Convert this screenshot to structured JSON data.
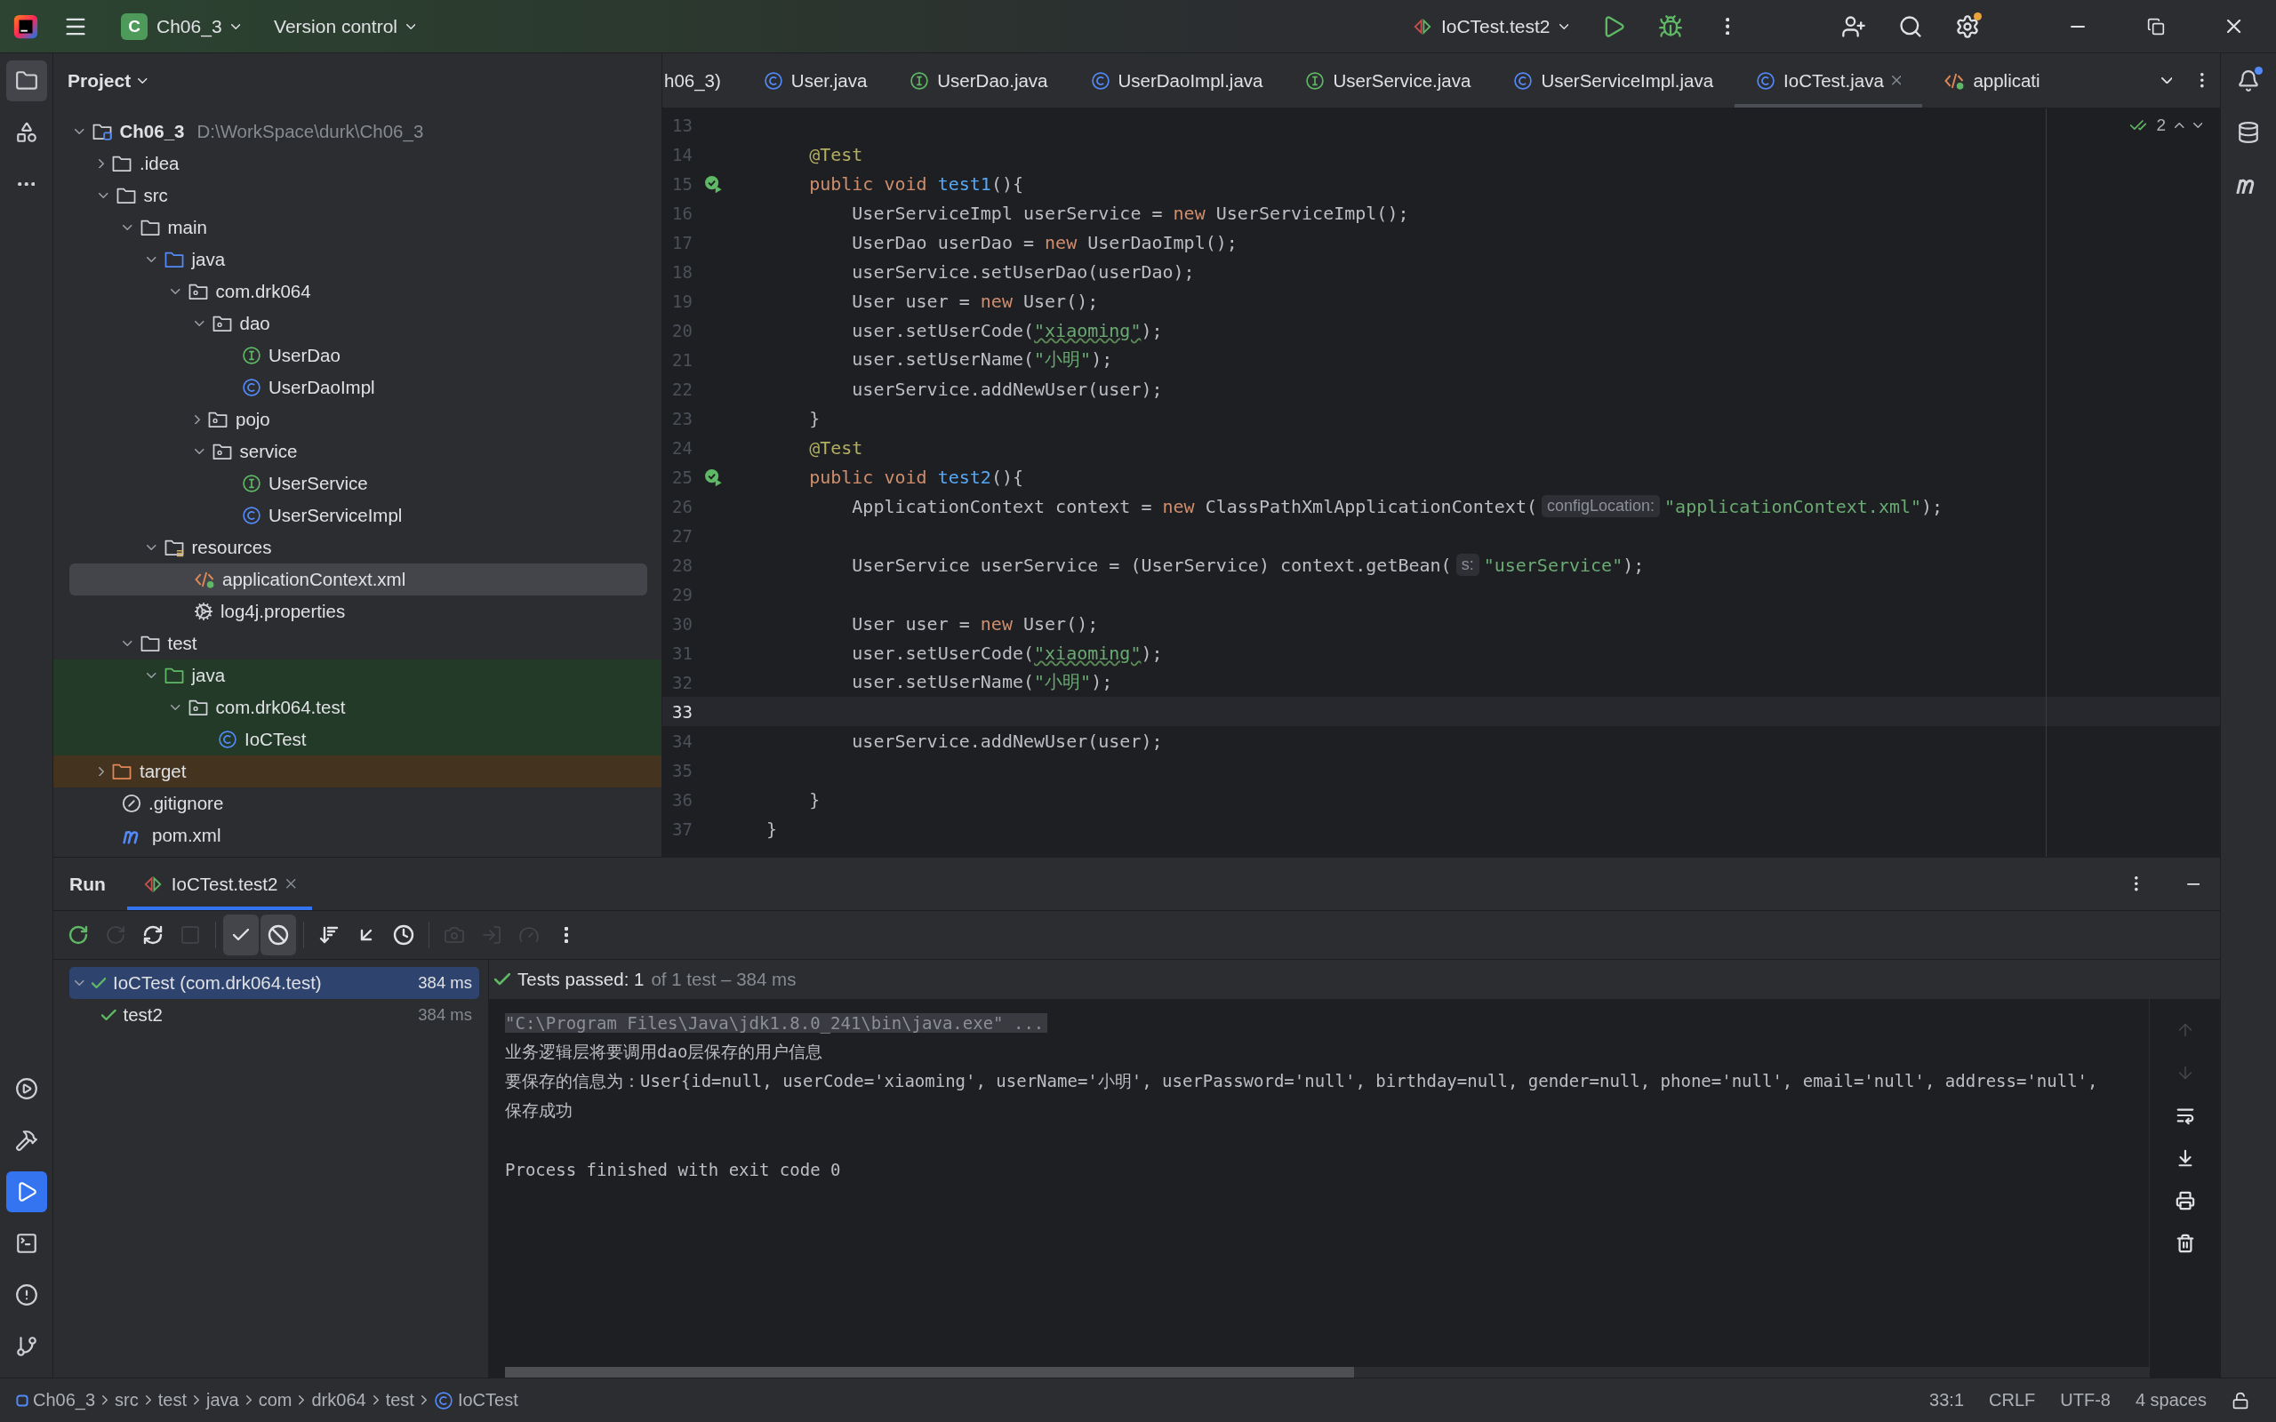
{
  "title_bar": {
    "project_badge": "C",
    "project": "Ch06_3",
    "vcs": "Version control",
    "run_config": "IoCTest.test2",
    "settings_badge": true
  },
  "left_tools": {
    "top": [
      {
        "kind": "project",
        "selected": true
      },
      {
        "kind": "structure",
        "selected": false
      },
      {
        "kind": "more",
        "selected": false
      }
    ],
    "bottom": [
      {
        "kind": "services",
        "selected": false
      },
      {
        "kind": "build",
        "selected": false
      },
      {
        "kind": "run",
        "selected": true
      },
      {
        "kind": "terminal",
        "selected": false
      },
      {
        "kind": "problems",
        "selected": false
      },
      {
        "kind": "git",
        "selected": false
      }
    ]
  },
  "right_tools": [
    {
      "kind": "notifications",
      "badge": true
    },
    {
      "kind": "database",
      "badge": false
    },
    {
      "kind": "maven",
      "badge": false
    }
  ],
  "project_panel": {
    "title": "Project",
    "tree": [
      {
        "label": "Ch06_3",
        "path": "D:\\WorkSpace\\durk\\Ch06_3",
        "kind": "module",
        "expanded": true,
        "selected": false,
        "test_sources": false,
        "children": [
          {
            "label": ".idea",
            "kind": "folder",
            "expanded": false,
            "selected": false,
            "test_sources": false
          },
          {
            "label": "src",
            "kind": "folder",
            "expanded": true,
            "selected": false,
            "test_sources": false,
            "children": [
              {
                "label": "main",
                "kind": "folder",
                "expanded": true,
                "selected": false,
                "test_sources": false,
                "children": [
                  {
                    "label": "java",
                    "kind": "source-folder",
                    "expanded": true,
                    "selected": false,
                    "test_sources": false,
                    "children": [
                      {
                        "label": "com.drk064",
                        "kind": "package",
                        "expanded": true,
                        "selected": false,
                        "test_sources": false,
                        "children": [
                          {
                            "label": "dao",
                            "kind": "package",
                            "expanded": true,
                            "selected": false,
                            "test_sources": false,
                            "children": [
                              {
                                "label": "UserDao",
                                "kind": "interface",
                                "selected": false,
                                "test_sources": false
                              },
                              {
                                "label": "UserDaoImpl",
                                "kind": "class",
                                "selected": false,
                                "test_sources": false
                              }
                            ]
                          },
                          {
                            "label": "pojo",
                            "kind": "package",
                            "expanded": false,
                            "selected": false,
                            "test_sources": false
                          },
                          {
                            "label": "service",
                            "kind": "package",
                            "expanded": true,
                            "selected": false,
                            "test_sources": false,
                            "children": [
                              {
                                "label": "UserService",
                                "kind": "interface",
                                "selected": false,
                                "test_sources": false
                              },
                              {
                                "label": "UserServiceImpl",
                                "kind": "class",
                                "selected": false,
                                "test_sources": false
                              }
                            ]
                          }
                        ]
                      }
                    ]
                  },
                  {
                    "label": "resources",
                    "kind": "resources-folder",
                    "expanded": true,
                    "selected": false,
                    "test_sources": false,
                    "children": [
                      {
                        "label": "applicationContext.xml",
                        "kind": "xml",
                        "selected": true,
                        "test_sources": false
                      },
                      {
                        "label": "log4j.properties",
                        "kind": "properties",
                        "selected": false,
                        "test_sources": false
                      }
                    ]
                  }
                ]
              },
              {
                "label": "test",
                "kind": "folder",
                "expanded": true,
                "selected": false,
                "test_sources": false,
                "children": [
                  {
                    "label": "java",
                    "kind": "test-folder",
                    "expanded": true,
                    "selected": false,
                    "test_sources": true,
                    "children": [
                      {
                        "label": "com.drk064.test",
                        "kind": "package",
                        "expanded": true,
                        "selected": false,
                        "test_sources": true,
                        "children": [
                          {
                            "label": "IoCTest",
                            "kind": "class",
                            "selected": false,
                            "test_sources": true
                          }
                        ]
                      }
                    ]
                  }
                ]
              }
            ]
          },
          {
            "label": "target",
            "kind": "excluded-folder",
            "expanded": false,
            "selected": false,
            "test_sources": false
          },
          {
            "label": ".gitignore",
            "kind": "ignore",
            "selected": false,
            "test_sources": false
          },
          {
            "label": "pom.xml",
            "kind": "maven",
            "selected": false,
            "test_sources": false
          }
        ]
      }
    ]
  },
  "editor": {
    "tabs": [
      {
        "label": "h06_3)",
        "kind": "none",
        "selected": false
      },
      {
        "label": "User.java",
        "kind": "class",
        "selected": false
      },
      {
        "label": "UserDao.java",
        "kind": "interface",
        "selected": false
      },
      {
        "label": "UserDaoImpl.java",
        "kind": "class",
        "selected": false
      },
      {
        "label": "UserService.java",
        "kind": "interface",
        "selected": false
      },
      {
        "label": "UserServiceImpl.java",
        "kind": "class",
        "selected": false
      },
      {
        "label": "IoCTest.java",
        "kind": "class",
        "selected": true
      },
      {
        "label": "applicati",
        "kind": "xml",
        "selected": false
      }
    ],
    "inspection_count": "2",
    "lines": [
      {
        "number": "13",
        "current": false,
        "run_marker": false
      },
      {
        "number": "14",
        "current": false,
        "run_marker": false,
        "tokens": [
          {
            "kind": "annotation",
            "text": "    @Test"
          }
        ]
      },
      {
        "number": "15",
        "current": false,
        "run_marker": true,
        "tokens": [
          {
            "kind": "keyword",
            "text": "    public void "
          },
          {
            "kind": "declaration",
            "text": "test1"
          },
          {
            "kind": "plain",
            "text": "(){"
          }
        ]
      },
      {
        "number": "16",
        "current": false,
        "run_marker": false,
        "tokens": [
          {
            "kind": "plain",
            "text": "        UserServiceImpl userService = "
          },
          {
            "kind": "keyword",
            "text": "new"
          },
          {
            "kind": "plain",
            "text": " UserServiceImpl();"
          }
        ]
      },
      {
        "number": "17",
        "current": false,
        "run_marker": false,
        "tokens": [
          {
            "kind": "plain",
            "text": "        UserDao userDao = "
          },
          {
            "kind": "keyword",
            "text": "new"
          },
          {
            "kind": "plain",
            "text": " UserDaoImpl();"
          }
        ]
      },
      {
        "number": "18",
        "current": false,
        "run_marker": false,
        "tokens": [
          {
            "kind": "plain",
            "text": "        userService.setUserDao(userDao);"
          }
        ]
      },
      {
        "number": "19",
        "current": false,
        "run_marker": false,
        "tokens": [
          {
            "kind": "plain",
            "text": "        User user = "
          },
          {
            "kind": "keyword",
            "text": "new"
          },
          {
            "kind": "plain",
            "text": " User();"
          }
        ]
      },
      {
        "number": "20",
        "current": false,
        "run_marker": false,
        "tokens": [
          {
            "kind": "plain",
            "text": "        user.setUserCode("
          },
          {
            "kind": "string-typo",
            "text": "\"xiaoming\""
          },
          {
            "kind": "plain",
            "text": ");"
          }
        ]
      },
      {
        "number": "21",
        "current": false,
        "run_marker": false,
        "tokens": [
          {
            "kind": "plain",
            "text": "        user.setUserName("
          },
          {
            "kind": "string",
            "text": "\"小明\""
          },
          {
            "kind": "plain",
            "text": ");"
          }
        ]
      },
      {
        "number": "22",
        "current": false,
        "run_marker": false,
        "tokens": [
          {
            "kind": "plain",
            "text": "        userService.addNewUser(user);"
          }
        ]
      },
      {
        "number": "23",
        "current": false,
        "run_marker": false,
        "tokens": [
          {
            "kind": "plain",
            "text": "    }"
          }
        ]
      },
      {
        "number": "24",
        "current": false,
        "run_marker": false,
        "tokens": [
          {
            "kind": "annotation",
            "text": "    @Test"
          }
        ]
      },
      {
        "number": "25",
        "current": false,
        "run_marker": true,
        "tokens": [
          {
            "kind": "keyword",
            "text": "    public void "
          },
          {
            "kind": "declaration",
            "text": "test2"
          },
          {
            "kind": "plain",
            "text": "(){"
          }
        ]
      },
      {
        "number": "26",
        "current": false,
        "run_marker": false,
        "tokens": [
          {
            "kind": "plain",
            "text": "        ApplicationContext context = "
          },
          {
            "kind": "keyword",
            "text": "new"
          },
          {
            "kind": "plain",
            "text": " ClassPathXmlApplicationContext("
          },
          {
            "kind": "hint",
            "text": "configLocation:"
          },
          {
            "kind": "string",
            "text": "\"applicationContext.xml\""
          },
          {
            "kind": "plain",
            "text": ");"
          }
        ]
      },
      {
        "number": "27",
        "current": false,
        "run_marker": false
      },
      {
        "number": "28",
        "current": false,
        "run_marker": false,
        "tokens": [
          {
            "kind": "plain",
            "text": "        UserService userService = (UserService) context.getBean("
          },
          {
            "kind": "hint",
            "text": "s:"
          },
          {
            "kind": "string",
            "text": "\"userService\""
          },
          {
            "kind": "plain",
            "text": ");"
          }
        ]
      },
      {
        "number": "29",
        "current": false,
        "run_marker": false
      },
      {
        "number": "30",
        "current": false,
        "run_marker": false,
        "tokens": [
          {
            "kind": "plain",
            "text": "        User user = "
          },
          {
            "kind": "keyword",
            "text": "new"
          },
          {
            "kind": "plain",
            "text": " User();"
          }
        ]
      },
      {
        "number": "31",
        "current": false,
        "run_marker": false,
        "tokens": [
          {
            "kind": "plain",
            "text": "        user.setUserCode("
          },
          {
            "kind": "string-typo",
            "text": "\"xiaoming\""
          },
          {
            "kind": "plain",
            "text": ");"
          }
        ]
      },
      {
        "number": "32",
        "current": false,
        "run_marker": false,
        "tokens": [
          {
            "kind": "plain",
            "text": "        user.setUserName("
          },
          {
            "kind": "string",
            "text": "\"小明\""
          },
          {
            "kind": "plain",
            "text": ");"
          }
        ]
      },
      {
        "number": "33",
        "current": true,
        "run_marker": false
      },
      {
        "number": "34",
        "current": false,
        "run_marker": false,
        "tokens": [
          {
            "kind": "plain",
            "text": "        userService.addNewUser(user);"
          }
        ]
      },
      {
        "number": "35",
        "current": false,
        "run_marker": false
      },
      {
        "number": "36",
        "current": false,
        "run_marker": false,
        "tokens": [
          {
            "kind": "plain",
            "text": "    }"
          }
        ]
      },
      {
        "number": "37",
        "current": false,
        "run_marker": false,
        "tokens": [
          {
            "kind": "plain",
            "text": "}"
          }
        ]
      }
    ]
  },
  "run_panel": {
    "title": "Run",
    "tabs": [
      {
        "label": "IoCTest.test2",
        "selected": true
      }
    ],
    "toolbar": [
      {
        "kind": "rerun",
        "disabled": false
      },
      {
        "kind": "rerun-failed",
        "disabled": true
      },
      {
        "kind": "toggle-rerun",
        "disabled": false
      },
      {
        "kind": "stop",
        "disabled": true
      },
      {
        "kind": "separator"
      },
      {
        "kind": "show-passed",
        "on": true
      },
      {
        "kind": "show-ignored",
        "on": true
      },
      {
        "kind": "separator"
      },
      {
        "kind": "sort",
        "disabled": false
      },
      {
        "kind": "export",
        "disabled": false
      },
      {
        "kind": "history",
        "disabled": false
      },
      {
        "kind": "separator"
      },
      {
        "kind": "screenshot",
        "disabled": true
      },
      {
        "kind": "import",
        "disabled": true
      },
      {
        "kind": "profile",
        "disabled": true
      },
      {
        "kind": "more",
        "disabled": false
      }
    ],
    "tests": [
      {
        "label": "IoCTest (com.drk064.test)",
        "time": "384 ms",
        "selected": true,
        "expanded": true,
        "children": [
          {
            "label": "test2",
            "time": "384 ms",
            "selected": false
          }
        ]
      }
    ],
    "summary": "Tests passed: 1",
    "summary_detail": "of 1 test – 384 ms",
    "console": [
      {
        "kind": "command",
        "text": "\"C:\\Program Files\\Java\\jdk1.8.0_241\\bin\\java.exe\" ..."
      },
      {
        "kind": "output",
        "text": "业务逻辑层将要调用dao层保存的用户信息"
      },
      {
        "kind": "output",
        "text": "要保存的信息为：User{id=null, userCode='xiaoming', userName='小明', userPassword='null', birthday=null, gender=null, phone='null', email='null', address='null',"
      },
      {
        "kind": "output",
        "text": "保存成功"
      },
      {
        "kind": "blank"
      },
      {
        "kind": "system",
        "text": "Process finished with exit code 0"
      }
    ],
    "console_tools": [
      {
        "kind": "up",
        "disabled": true
      },
      {
        "kind": "down",
        "disabled": true
      },
      {
        "kind": "wrap",
        "disabled": false
      },
      {
        "kind": "scroll-end",
        "disabled": false
      },
      {
        "kind": "print",
        "disabled": false
      },
      {
        "kind": "clear",
        "disabled": false
      }
    ]
  },
  "status_bar": {
    "breadcrumbs": [
      {
        "label": "Ch06_3",
        "kind": "module"
      },
      {
        "label": "src",
        "kind": "none"
      },
      {
        "label": "test",
        "kind": "none"
      },
      {
        "label": "java",
        "kind": "none"
      },
      {
        "label": "com",
        "kind": "none"
      },
      {
        "label": "drk064",
        "kind": "none"
      },
      {
        "label": "test",
        "kind": "none"
      },
      {
        "label": "IoCTest",
        "kind": "class"
      }
    ],
    "items": [
      "33:1",
      "CRLF",
      "UTF-8",
      "4 spaces"
    ]
  }
}
